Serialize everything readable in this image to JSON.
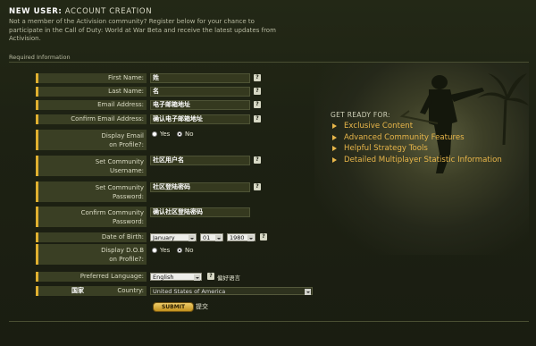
{
  "header": {
    "title_strong": "NEW USER:",
    "title_rest": " ACCOUNT CREATION",
    "intro": "Not a member of the Activision community? Register below for your chance to participate in the Call of Duty: World at War Beta and receive the latest updates from Activision.",
    "required_label": "Required Information"
  },
  "form": {
    "first_name": {
      "label": "First Name:",
      "value": "姓",
      "help": "?"
    },
    "last_name": {
      "label": "Last Name:",
      "value": "名",
      "help": "?"
    },
    "email": {
      "label": "Email Address:",
      "value": "电子邮箱地址",
      "help": "?"
    },
    "confirm_email": {
      "label": "Confirm Email Address:",
      "value": "确认电子邮箱地址",
      "help": "?"
    },
    "display_email": {
      "label_line1": "Display Email",
      "label_line2": "on Profile?:",
      "yes": "Yes",
      "no": "No",
      "selected": "No"
    },
    "username": {
      "label_line1": "Set Community",
      "label_line2": "Username:",
      "value": "社区用户名",
      "help": "?"
    },
    "password": {
      "label_line1": "Set Community",
      "label_line2": "Password:",
      "value": "社区登陆密码",
      "help": "?"
    },
    "confirm_password": {
      "label_line1": "Confirm Community",
      "label_line2": "Password:",
      "value": "确认社区登陆密码"
    },
    "dob": {
      "label": "Date of Birth:",
      "month": "January",
      "day": "01",
      "year": "1980",
      "help": "?"
    },
    "display_dob": {
      "label_line1": "Display D.O.B",
      "label_line2": "on Profile?:",
      "yes": "Yes",
      "no": "No",
      "selected": "No"
    },
    "language": {
      "label": "Preferred Language:",
      "value": "English",
      "help": "?",
      "note": "偏好语言"
    },
    "country": {
      "label_cn": "国家",
      "label": "Country:",
      "value": "United States of America"
    },
    "submit": {
      "label": "SUBMIT",
      "note": "提交"
    }
  },
  "promo": {
    "title": "GET READY FOR:",
    "items": [
      "Exclusive Content",
      "Advanced Community Features",
      "Helpful Strategy Tools",
      "Detailed Multiplayer Statistic Information"
    ]
  },
  "colors": {
    "accent": "#e8b64a",
    "label_bg": "#3a3f24",
    "background": "#1b1f12"
  }
}
